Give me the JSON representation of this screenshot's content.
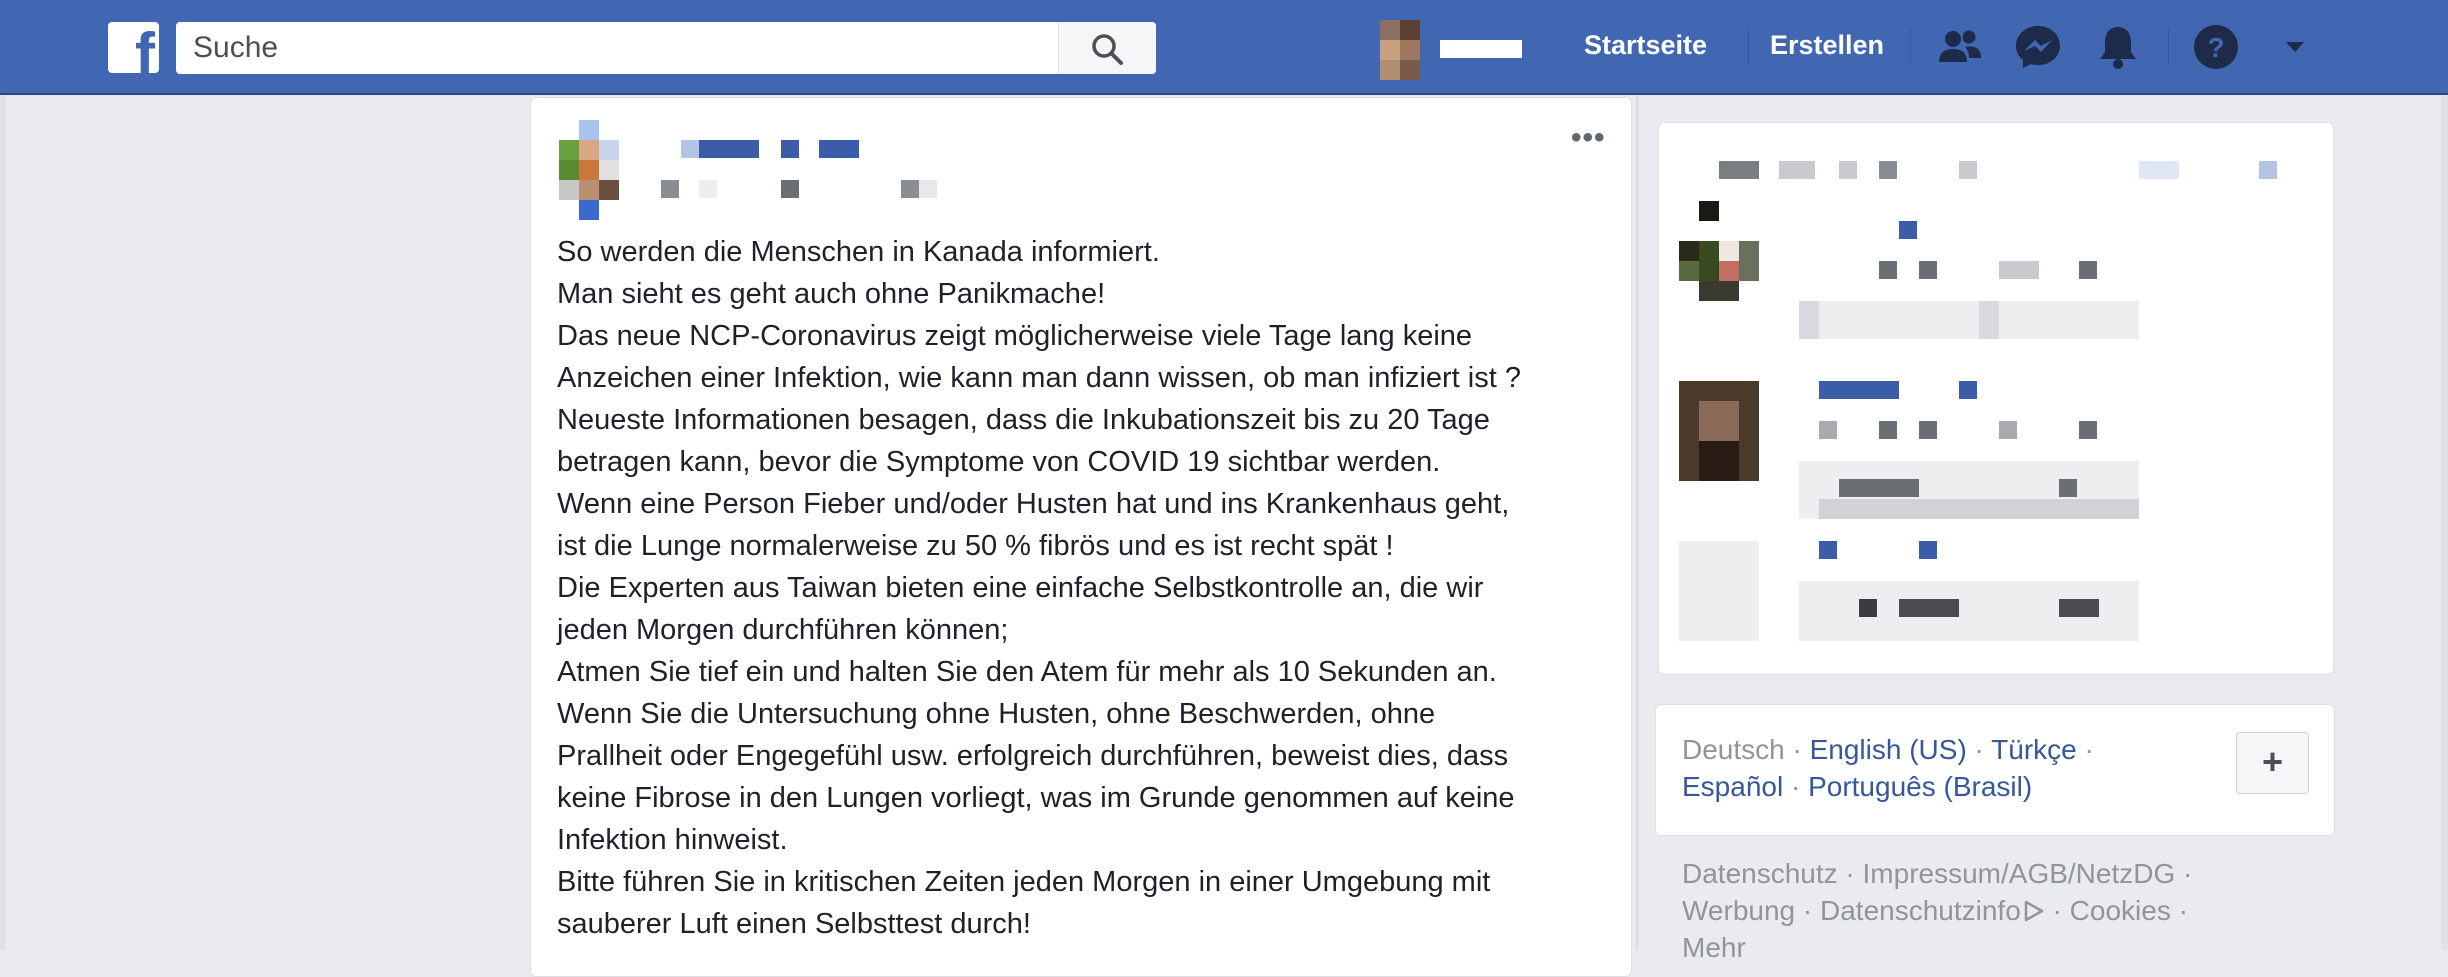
{
  "header": {
    "logo": "f",
    "search_placeholder": "Suche",
    "nav": {
      "home": "Startseite",
      "create": "Erstellen"
    },
    "icons": [
      "friends-icon",
      "messenger-icon",
      "notifications-icon",
      "help-icon",
      "dropdown-icon"
    ],
    "brand_color": "#4267b2"
  },
  "post": {
    "menu_glyph": "•••",
    "lines": [
      "So werden die Menschen in Kanada informiert.",
      "Man sieht es geht auch ohne Panikmache!",
      "Das neue NCP-Coronavirus zeigt möglicherweise viele Tage lang keine",
      "Anzeichen einer Infektion, wie kann man dann wissen, ob man infiziert ist ?",
      "Neueste Informationen besagen, dass die Inkubationszeit bis zu 20 Tage",
      "betragen kann, bevor die Symptome von COVID 19 sichtbar werden.",
      "Wenn eine Person Fieber und/oder Husten hat und ins Krankenhaus geht,",
      "ist die Lunge normalerweise zu 50 % fibrös und es ist recht spät !",
      "Die Experten aus Taiwan bieten eine einfache Selbstkontrolle an, die wir",
      "jeden Morgen durchführen können;",
      "Atmen Sie tief ein und halten Sie den Atem für mehr als 10 Sekunden an.",
      "Wenn Sie die Untersuchung ohne Husten, ohne Beschwerden, ohne",
      "Prallheit oder Engegefühl usw. erfolgreich durchführen, beweist dies, dass",
      "keine Fibrose in den Lungen vorliegt, was im Grunde genommen auf keine",
      "Infektion hinweist.",
      "Bitte führen Sie in kritischen Zeiten jeden Morgen in einer Umgebung mit",
      "sauberer Luft einen Selbsttest durch!"
    ]
  },
  "languages": {
    "current": "Deutsch",
    "sep": " · ",
    "links": [
      "English (US)",
      "Türkçe",
      "Español",
      "Português (Brasil)"
    ],
    "add_label": "+"
  },
  "footer": {
    "line1": "Datenschutz · Impressum/AGB/NetzDG ·",
    "line2a": "Werbung · Datenschutzinfo",
    "line2b": " · Cookies ·",
    "line3": "Mehr"
  }
}
